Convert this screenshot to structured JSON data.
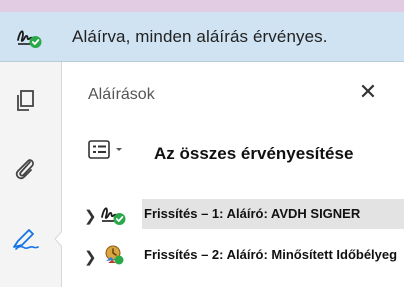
{
  "banner": {
    "message": "Aláírva, minden aláírás érvényes.",
    "icon": "signature-valid-icon"
  },
  "sidebar": {
    "items": [
      {
        "icon": "pages-icon"
      },
      {
        "icon": "attachment-icon"
      },
      {
        "icon": "signature-panel-icon",
        "selected": true
      }
    ]
  },
  "panel": {
    "title": "Aláírások",
    "close_icon": "close-icon",
    "options_icon": "options-menu-icon",
    "validate_all_label": "Az összes érvényesítése"
  },
  "signatures": [
    {
      "label": "Frissítés – 1: Aláíró: AVDH SIGNER",
      "icon": "signature-valid-icon",
      "selected": true
    },
    {
      "label": "Frissítés – 2: Aláíró: Minősített Időbélyeg",
      "icon": "timestamp-signature-icon",
      "selected": false
    }
  ],
  "colors": {
    "banner_bg": "#cfe3f2",
    "top_band": "#e2cce3",
    "sidebar_bg": "#f4f4f4",
    "selected_row": "#e3e3e3",
    "valid_green": "#2aa84a",
    "sidebar_icon_active": "#1473e6"
  }
}
